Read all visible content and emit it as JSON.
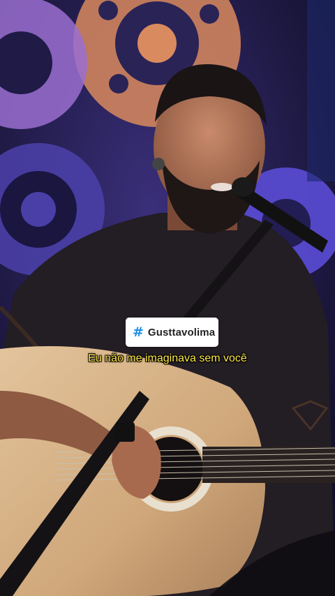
{
  "overlay": {
    "hashtag_symbol": "#",
    "hashtag_text": "Gusttavolima",
    "subtitle": "Eu não me imaginava sem você"
  },
  "colors": {
    "hashtag_accent": "#1d8fe6",
    "subtitle": "#ffe94a"
  },
  "icons": [
    "hashtag-icon"
  ]
}
